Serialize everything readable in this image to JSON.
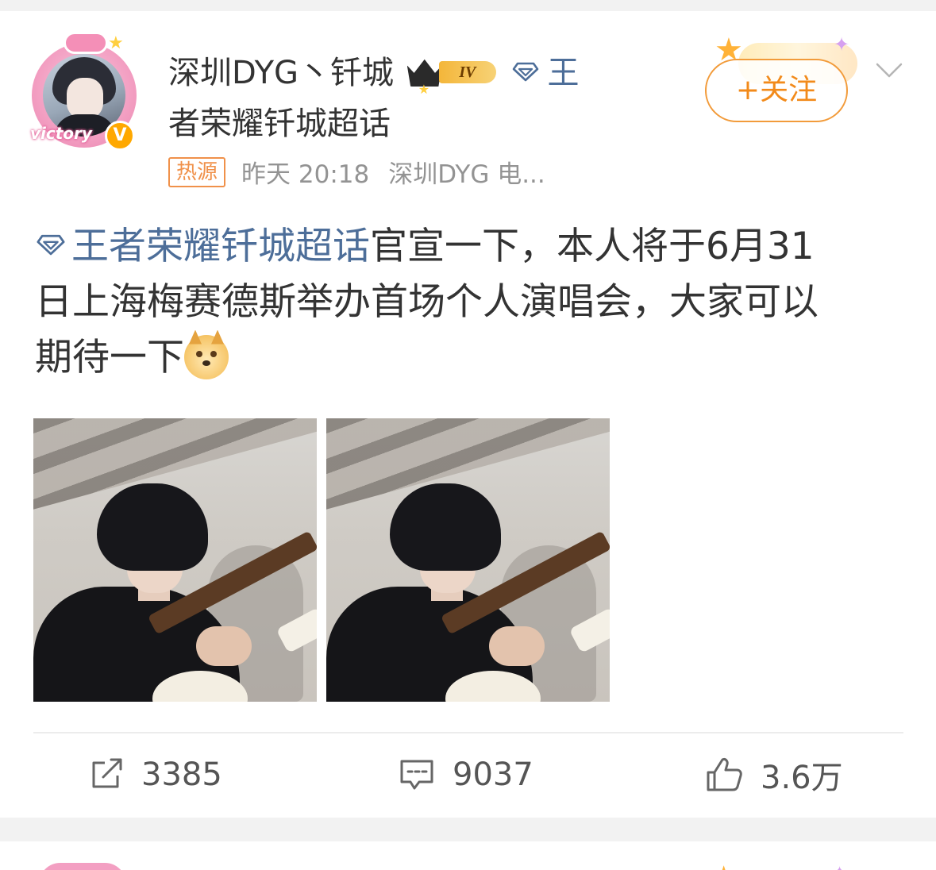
{
  "post": {
    "author": {
      "name": "深圳DYG丶钎城",
      "level_badge": "IV",
      "verified_mark": "V",
      "avatar_caption": "victory",
      "topic_suffix_line1": "王",
      "topic_suffix_line2": "者荣耀钎城超话"
    },
    "meta": {
      "hot_badge": "热源",
      "time": "昨天 20:18",
      "source": "深圳DYG 电..."
    },
    "follow_button": "+关注",
    "content": {
      "topic_link": "王者荣耀钎城超话",
      "line1_rest": "官宣一下，本人将于6月31",
      "line2": "日上海梅赛德斯举办首场个人演唱会，大家可以",
      "line3": "期待一下"
    },
    "images": [
      {
        "name": "photo-1"
      },
      {
        "name": "photo-2"
      }
    ],
    "actions": {
      "repost_count": "3385",
      "comment_count": "9037",
      "like_count": "3.6万"
    }
  },
  "colors": {
    "topic_blue": "#4d6e99",
    "follow_orange": "#f28a1a",
    "hot_orange": "#f0914a",
    "meta_gray": "#939393"
  },
  "icons": {
    "repost": "repost-icon",
    "comment": "comment-icon",
    "like": "thumbs-up-icon",
    "menu": "chevron-down-icon",
    "topic": "diamond-icon",
    "emoji": "doge-emoji-icon"
  }
}
